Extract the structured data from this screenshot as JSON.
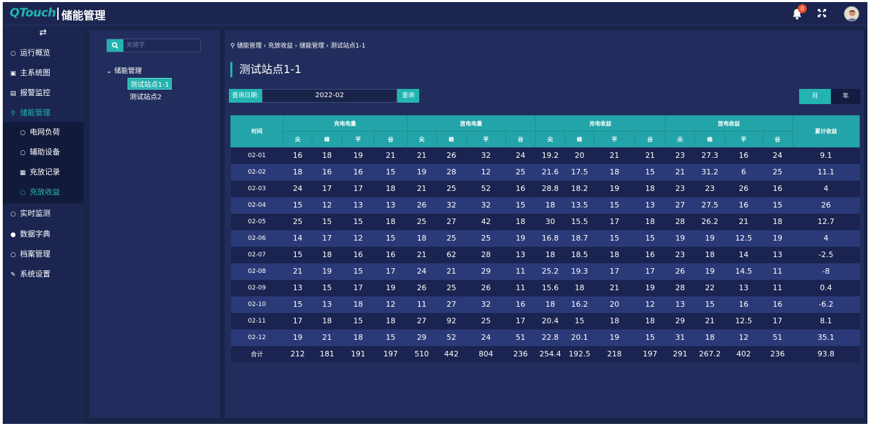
{
  "app": {
    "logo": "QTouch",
    "title": "储能管理"
  },
  "header": {
    "notification_count": "0"
  },
  "sidebar": {
    "items": [
      {
        "label": "运行概览",
        "icon": "circle-icon"
      },
      {
        "label": "主系统图",
        "icon": "image-icon"
      },
      {
        "label": "报警监控",
        "icon": "document-icon"
      },
      {
        "label": "储能管理",
        "icon": "location-icon"
      },
      {
        "label": "实时监测",
        "icon": "circle-icon"
      },
      {
        "label": "数据字典",
        "icon": "dot-icon"
      },
      {
        "label": "档案管理",
        "icon": "circle-icon"
      },
      {
        "label": "系统设置",
        "icon": "wrench-icon"
      }
    ],
    "subitems": [
      {
        "label": "电网负荷"
      },
      {
        "label": "辅助设备"
      },
      {
        "label": "充放记录"
      },
      {
        "label": "充放收益"
      }
    ]
  },
  "tree": {
    "search_placeholder": "关键字",
    "root": "储能管理",
    "leaves": [
      "测试站点1-1",
      "测试站点2"
    ]
  },
  "main": {
    "breadcrumb": "储能管理 › 充放收益 › 储能管理 › 测试站点1-1",
    "title": "测试站点1-1",
    "query_label": "查询日期:",
    "query_date": "2022-02",
    "query_button": "查询",
    "toggle_month": "月",
    "toggle_year": "年"
  },
  "table": {
    "col_time": "时间",
    "groups": [
      "充电电量",
      "放电电量",
      "充电收益",
      "放电收益"
    ],
    "sub": [
      "尖",
      "峰",
      "平",
      "谷"
    ],
    "col_total": "累计收益",
    "rows": [
      [
        "02-01",
        "16",
        "18",
        "19",
        "21",
        "21",
        "26",
        "32",
        "24",
        "19.2",
        "20",
        "21",
        "21",
        "23",
        "27.3",
        "16",
        "24",
        "9.1"
      ],
      [
        "02-02",
        "18",
        "16",
        "16",
        "15",
        "19",
        "28",
        "12",
        "25",
        "21.6",
        "17.5",
        "18",
        "15",
        "21",
        "31.2",
        "6",
        "25",
        "11.1"
      ],
      [
        "02-03",
        "24",
        "17",
        "17",
        "18",
        "21",
        "25",
        "52",
        "16",
        "28.8",
        "18.2",
        "19",
        "18",
        "23",
        "23",
        "26",
        "16",
        "4"
      ],
      [
        "02-04",
        "15",
        "12",
        "13",
        "13",
        "26",
        "32",
        "32",
        "15",
        "18",
        "13.5",
        "15",
        "13",
        "27",
        "27.5",
        "16",
        "15",
        "26"
      ],
      [
        "02-05",
        "25",
        "15",
        "15",
        "18",
        "25",
        "27",
        "42",
        "18",
        "30",
        "15.5",
        "17",
        "18",
        "28",
        "26.2",
        "21",
        "18",
        "12.7"
      ],
      [
        "02-06",
        "14",
        "17",
        "12",
        "15",
        "18",
        "25",
        "25",
        "19",
        "16.8",
        "18.7",
        "15",
        "15",
        "19",
        "19",
        "12.5",
        "19",
        "4"
      ],
      [
        "02-07",
        "15",
        "18",
        "16",
        "16",
        "21",
        "62",
        "28",
        "13",
        "18",
        "18.5",
        "18",
        "16",
        "23",
        "18",
        "14",
        "13",
        "-2.5"
      ],
      [
        "02-08",
        "21",
        "19",
        "15",
        "17",
        "24",
        "21",
        "29",
        "11",
        "25.2",
        "19.3",
        "17",
        "17",
        "26",
        "19",
        "14.5",
        "11",
        "-8"
      ],
      [
        "02-09",
        "13",
        "15",
        "17",
        "19",
        "26",
        "25",
        "26",
        "11",
        "15.6",
        "18",
        "21",
        "19",
        "28",
        "22",
        "13",
        "11",
        "0.4"
      ],
      [
        "02-10",
        "15",
        "13",
        "18",
        "12",
        "11",
        "27",
        "32",
        "16",
        "18",
        "16.2",
        "20",
        "12",
        "13",
        "15",
        "16",
        "16",
        "-6.2"
      ],
      [
        "02-11",
        "17",
        "18",
        "15",
        "18",
        "27",
        "92",
        "25",
        "17",
        "20.4",
        "15",
        "18",
        "18",
        "29",
        "21",
        "12.5",
        "17",
        "8.1"
      ],
      [
        "02-12",
        "19",
        "21",
        "18",
        "15",
        "29",
        "52",
        "24",
        "51",
        "22.8",
        "20.1",
        "19",
        "15",
        "31",
        "18",
        "12",
        "51",
        "35.1"
      ],
      [
        "合计",
        "212",
        "181",
        "191",
        "197",
        "510",
        "442",
        "804",
        "236",
        "254.4",
        "192.5",
        "218",
        "197",
        "291",
        "267.2",
        "402",
        "236",
        "93.8"
      ]
    ]
  },
  "colors": {
    "accent": "#23b4b0",
    "bg": "#1a2449",
    "panel": "#212d5c"
  }
}
